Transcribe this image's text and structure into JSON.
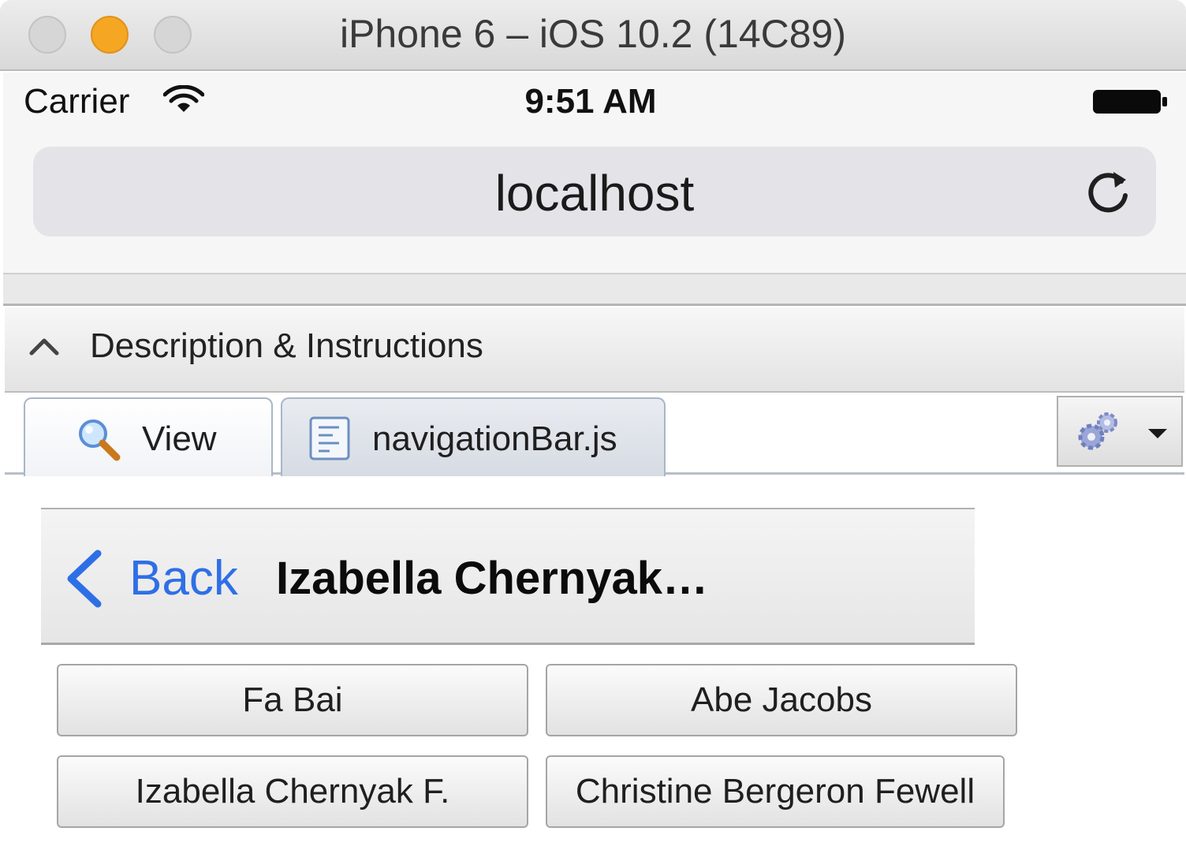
{
  "window": {
    "title": "iPhone 6 – iOS 10.2 (14C89)"
  },
  "status_bar": {
    "carrier": "Carrier",
    "time": "9:51 AM",
    "wifi_icon": "wifi-icon",
    "battery_icon": "battery-icon"
  },
  "browser": {
    "url": "localhost",
    "reload_icon": "reload-icon"
  },
  "description_panel": {
    "label": "Description & Instructions",
    "chevron_icon": "chevron-up-icon"
  },
  "tabs": [
    {
      "label": "View",
      "icon": "magnifier-icon",
      "active": true
    },
    {
      "label": "navigationBar.js",
      "icon": "js-file-icon",
      "active": false
    }
  ],
  "settings": {
    "icon": "gear-icon",
    "caret_icon": "caret-down-icon"
  },
  "navbar": {
    "back_label": "Back",
    "title": "Izabella Chernyak…",
    "back_color": "#2f6fe6"
  },
  "buttons": [
    {
      "label": "Fa Bai"
    },
    {
      "label": "Abe Jacobs"
    },
    {
      "label": "Izabella Chernyak F."
    },
    {
      "label": "Christine Bergeron Fewell"
    }
  ]
}
